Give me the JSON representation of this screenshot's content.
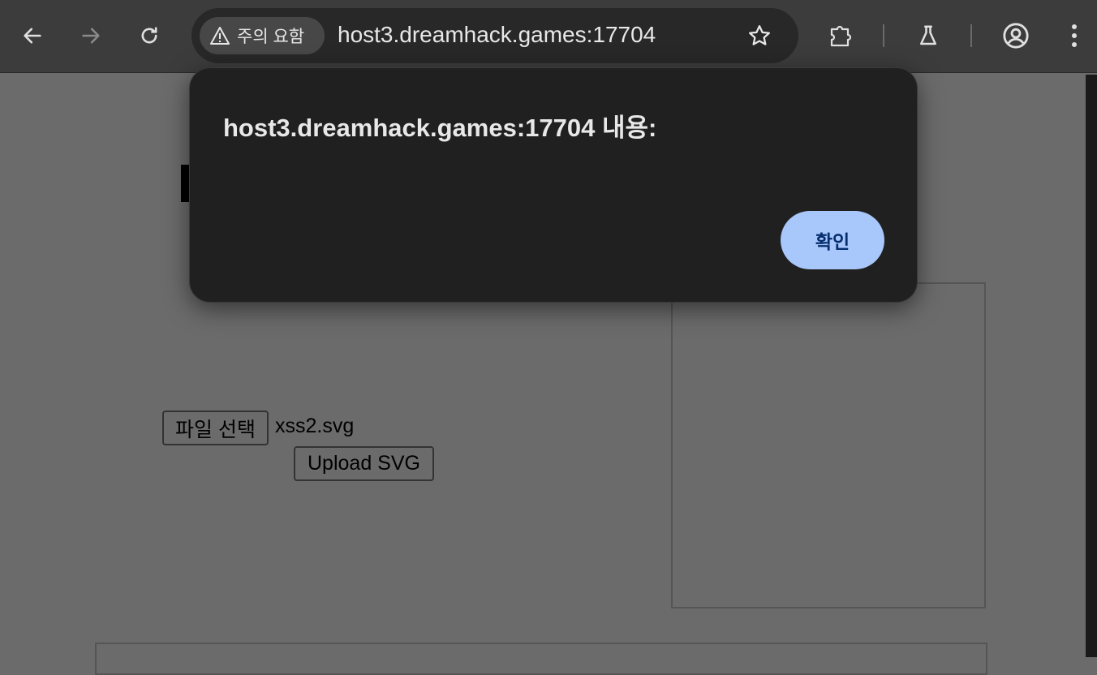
{
  "browser": {
    "security_label": "주의 요함",
    "url": "host3.dreamhack.games:17704",
    "icons": [
      "back-arrow-icon",
      "forward-arrow-icon",
      "reload-icon",
      "warning-icon",
      "star-icon",
      "extensions-icon",
      "labs-flask-icon",
      "profile-icon",
      "kebab-menu-icon"
    ]
  },
  "page": {
    "file_button_label": "파일 선택",
    "file_name": "xss2.svg",
    "upload_button_label": "Upload SVG"
  },
  "dialog": {
    "title": "host3.dreamhack.games:17704 내용:",
    "ok_label": "확인"
  },
  "colors": {
    "toolbar": "#3c3c3c",
    "omnibox": "#282828",
    "dialog_bg": "#202020",
    "ok_button": "#a8c7fa",
    "ok_text": "#062e6f",
    "page_dimmed": "#6b6b6b"
  }
}
